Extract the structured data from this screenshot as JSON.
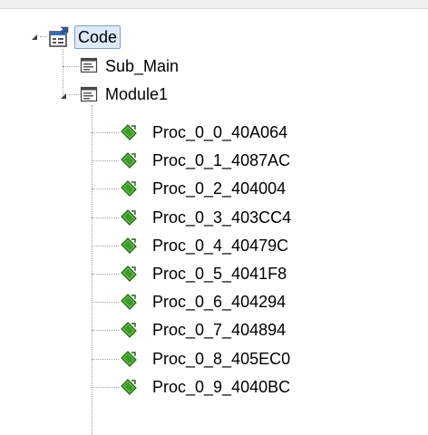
{
  "tree": {
    "root": {
      "label": "Code",
      "icon": "project-properties-icon",
      "expanded": true
    },
    "children": [
      {
        "label": "Sub_Main",
        "icon": "module-icon"
      },
      {
        "label": "Module1",
        "icon": "module-icon",
        "expanded": true,
        "procedures": [
          {
            "label": "Proc_0_0_40A064",
            "icon": "procedure-icon"
          },
          {
            "label": "Proc_0_1_4087AC",
            "icon": "procedure-icon"
          },
          {
            "label": "Proc_0_2_404004",
            "icon": "procedure-icon"
          },
          {
            "label": "Proc_0_3_403CC4",
            "icon": "procedure-icon"
          },
          {
            "label": "Proc_0_4_40479C",
            "icon": "procedure-icon"
          },
          {
            "label": "Proc_0_5_4041F8",
            "icon": "procedure-icon"
          },
          {
            "label": "Proc_0_6_404294",
            "icon": "procedure-icon"
          },
          {
            "label": "Proc_0_7_404894",
            "icon": "procedure-icon"
          },
          {
            "label": "Proc_0_8_405EC0",
            "icon": "procedure-icon"
          },
          {
            "label": "Proc_0_9_4040BC",
            "icon": "procedure-icon"
          }
        ]
      }
    ]
  },
  "colors": {
    "selection_fill": "#dcebfc",
    "selection_border": "#7da2ce",
    "connector": "#a0a0a0",
    "procedure_green": "#3aa33a"
  }
}
